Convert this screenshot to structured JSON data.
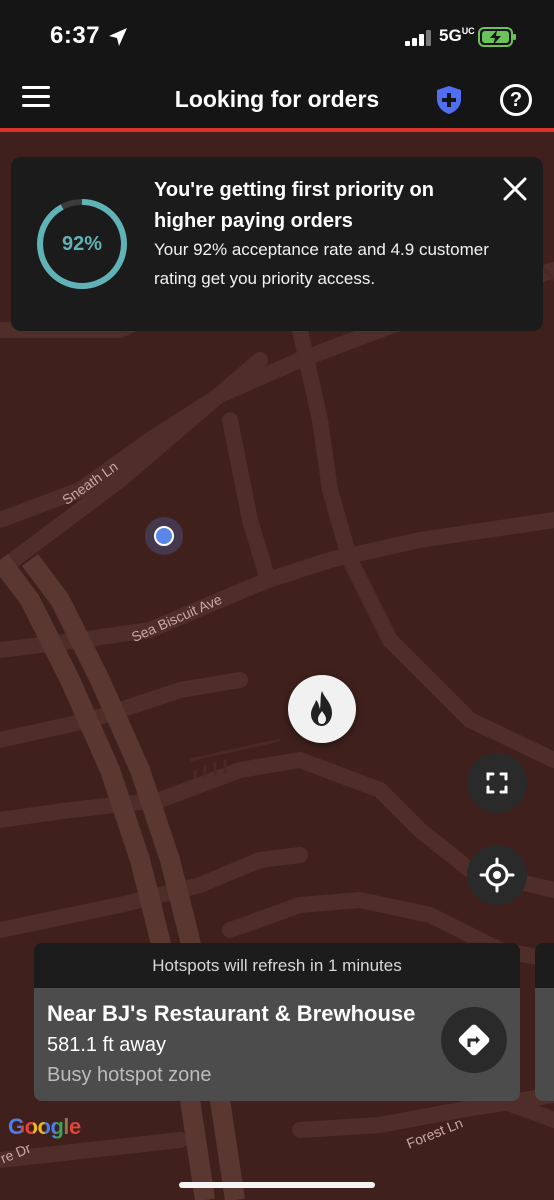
{
  "status_bar": {
    "time": "6:37",
    "network": "5G",
    "network_suffix": "UC",
    "location_icon": "location-arrow-icon",
    "signal_icon": "signal-bars-icon",
    "battery_icon": "battery-charging-icon"
  },
  "header": {
    "title": "Looking for orders",
    "menu_icon": "hamburger-menu-icon",
    "shield_icon": "safety-shield-icon",
    "help_icon": "help-icon",
    "help_glyph": "?",
    "accent_color": "#d9322a"
  },
  "priority_card": {
    "rate_label": "92%",
    "rate_value": 0.92,
    "title": "You're getting first priority on higher paying orders",
    "body": "Your 92% acceptance rate and 4.9 customer rating get you priority access.",
    "ring_color": "#5fb2b6",
    "close_icon": "close-icon"
  },
  "map": {
    "labels": {
      "sneath": "Sneath Ln",
      "sea_biscuit": "Sea Biscuit Ave",
      "forest": "Forest Ln",
      "dr_partial": "re Dr"
    },
    "flame_icon": "hotspot-flame-icon",
    "expand_icon": "expand-frame-icon",
    "recenter_icon": "recenter-location-icon",
    "user_marker": "user-location-dot"
  },
  "hotspot": {
    "refresh_text": "Hotspots will refresh in 1 minutes",
    "name": "Near BJ's Restaurant & Brewhouse",
    "distance": "581.1 ft away",
    "zone": "Busy hotspot zone",
    "nav_icon": "directions-turn-icon"
  },
  "footer": {
    "google": "Google"
  }
}
